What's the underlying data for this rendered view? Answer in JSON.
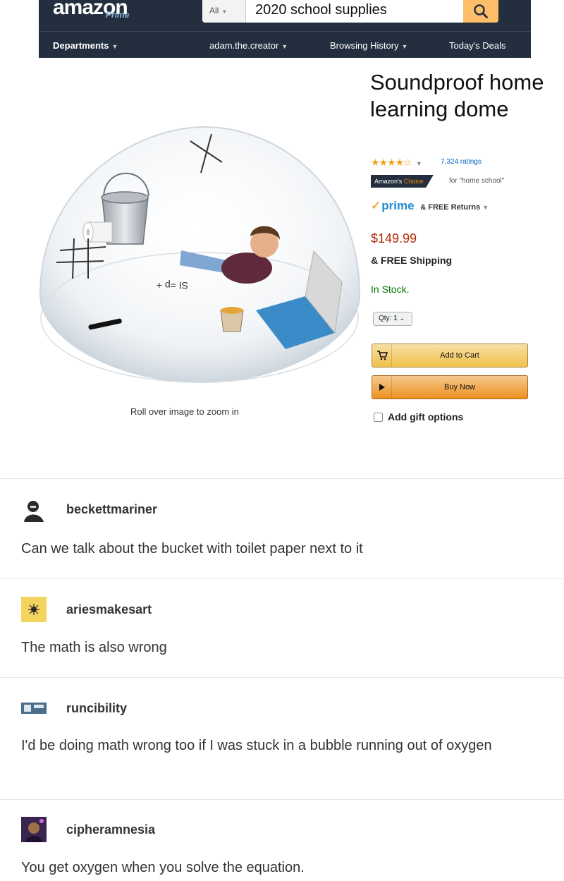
{
  "amazon": {
    "logo": "amazon",
    "logo_sub": "Prime",
    "search": {
      "category": "All",
      "query": "2020 school supplies"
    },
    "nav": {
      "departments": "Departments",
      "account": "adam.the.creator",
      "browsing_history": "Browsing History",
      "todays_deals": "Today's Deals"
    }
  },
  "product": {
    "title": "Soundproof home learning dome",
    "rating_stars": 4.5,
    "ratings_count": "7,324 ratings",
    "badge_main": "Amazon's",
    "badge_accent": "Choice",
    "badge_for": "for \"home school\"",
    "prime": "prime",
    "prime_returns": "& FREE Returns",
    "price": "$149.99",
    "shipping": "& FREE Shipping",
    "stock": "In Stock.",
    "qty_label": "Qty:",
    "qty_value": "1",
    "add_to_cart": "Add to Cart",
    "buy_now": "Buy Now",
    "gift_options": "Add gift options",
    "zoom_hint": "Roll over image to zoom in",
    "image_doodles": {
      "equation": "SI =p +",
      "scribbles": [
        "X",
        "O",
        "X"
      ]
    }
  },
  "comments": [
    {
      "username": "beckettmariner",
      "text": "Can we talk about the bucket with toilet paper next to it",
      "avatar_color": "#2b2b2b"
    },
    {
      "username": "ariesmakesart",
      "text": "The math is also wrong",
      "avatar_color": "#f4d35e"
    },
    {
      "username": "runcibility",
      "text": "I'd be doing math wrong too if I was stuck in a bubble running out of oxygen",
      "avatar_color": "#4a6d8c"
    },
    {
      "username": "cipheramnesia",
      "text": "You get oxygen when you solve the equation.",
      "avatar_color": "#3a2550"
    }
  ],
  "colors": {
    "amazon_navy": "#232f3e",
    "search_button": "#febd69",
    "price_red": "#b12704",
    "stock_green": "#007600",
    "prime_blue": "#1d8ed1"
  }
}
